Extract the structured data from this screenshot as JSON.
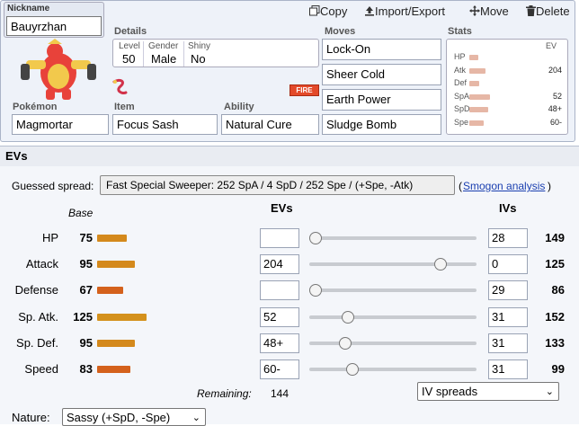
{
  "nickname": {
    "label": "Nickname",
    "value": "Bauyrzhan"
  },
  "toolbar": {
    "copy": "Copy",
    "import_export": "Import/Export",
    "move": "Move",
    "delete": "Delete"
  },
  "details": {
    "label": "Details",
    "level_label": "Level",
    "level": "50",
    "gender_label": "Gender",
    "gender": "Male",
    "shiny_label": "Shiny",
    "shiny": "No"
  },
  "type_badge": "FIRE",
  "pokemon": {
    "label": "Pokémon",
    "value": "Magmortar"
  },
  "item": {
    "label": "Item",
    "value": "Focus Sash"
  },
  "ability": {
    "label": "Ability",
    "value": "Natural Cure"
  },
  "moves": {
    "label": "Moves",
    "list": [
      "Lock-On",
      "Sheer Cold",
      "Earth Power",
      "Sludge Bomb"
    ]
  },
  "stats_panel": {
    "label": "Stats",
    "ev_header": "EV",
    "rows": [
      {
        "name": "HP",
        "ev": "",
        "fill": 0.16
      },
      {
        "name": "Atk",
        "ev": "204",
        "fill": 0.3
      },
      {
        "name": "Def",
        "ev": "",
        "fill": 0.18
      },
      {
        "name": "SpA",
        "ev": "52",
        "fill": 0.38
      },
      {
        "name": "SpD",
        "ev": "48+",
        "fill": 0.35
      },
      {
        "name": "Spe",
        "ev": "60-",
        "fill": 0.26
      }
    ]
  },
  "evs_section": {
    "title": "EVs",
    "guessed_label": "Guessed spread:",
    "guessed_button": "Fast Special Sweeper: 252 SpA / 4 SpD / 252 Spe / (+Spe, -Atk)",
    "smogon_link": "Smogon analysis",
    "paren_open": "(",
    "paren_close": ")",
    "base_header": "Base",
    "evs_header": "EVs",
    "ivs_header": "IVs",
    "rows": [
      {
        "label": "HP",
        "base": "75",
        "ev": "",
        "ev_slider": 0.0,
        "iv": "28",
        "total": "149",
        "bar_color": "#d4891c"
      },
      {
        "label": "Attack",
        "base": "95",
        "ev": "204",
        "ev_slider": 0.81,
        "iv": "0",
        "total": "125",
        "bar_color": "#d4891c"
      },
      {
        "label": "Defense",
        "base": "67",
        "ev": "",
        "ev_slider": 0.0,
        "iv": "29",
        "total": "86",
        "bar_color": "#d4611c"
      },
      {
        "label": "Sp. Atk.",
        "base": "125",
        "ev": "52",
        "ev_slider": 0.21,
        "iv": "31",
        "total": "152",
        "bar_color": "#d4911c"
      },
      {
        "label": "Sp. Def.",
        "base": "95",
        "ev": "48+",
        "ev_slider": 0.19,
        "iv": "31",
        "total": "133",
        "bar_color": "#d4891c"
      },
      {
        "label": "Speed",
        "base": "83",
        "ev": "60-",
        "ev_slider": 0.24,
        "iv": "31",
        "total": "99",
        "bar_color": "#d4611c"
      }
    ],
    "remaining_label": "Remaining:",
    "remaining_value": "144",
    "iv_spreads_select": "IV spreads",
    "nature_label": "Nature:",
    "nature_value": "Sassy (+SpD, -Spe)"
  },
  "icons": {
    "copy": "copy-icon",
    "import": "import-icon",
    "move": "move-arrows-icon",
    "delete": "trash-icon",
    "sprite": "magmortar-sprite-icon",
    "item_sprite": "focus-sash-icon"
  }
}
